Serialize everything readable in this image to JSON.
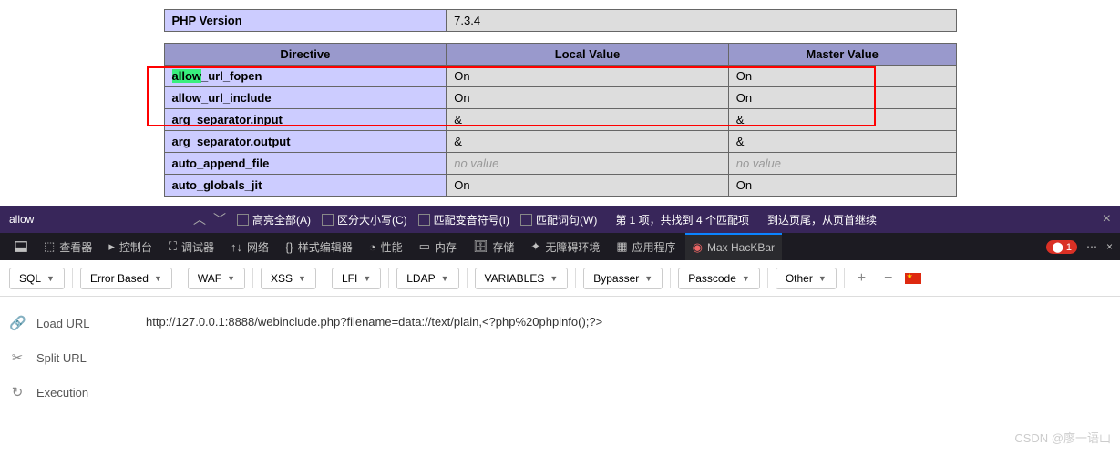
{
  "php_version_label": "PHP Version",
  "php_version_value": "7.3.4",
  "table_headers": {
    "directive": "Directive",
    "local": "Local Value",
    "master": "Master Value"
  },
  "directives": [
    {
      "name_prefix_hl": "allow",
      "name_rest": "_url_fopen",
      "local": "On",
      "master": "On"
    },
    {
      "name": "allow_url_include",
      "local": "On",
      "master": "On"
    },
    {
      "name": "arg_separator.input",
      "local": "&",
      "master": "&"
    },
    {
      "name": "arg_separator.output",
      "local": "&",
      "master": "&"
    },
    {
      "name": "auto_append_file",
      "local": "no value",
      "master": "no value",
      "novalue": true
    },
    {
      "name": "auto_globals_jit",
      "local": "On",
      "master": "On"
    }
  ],
  "search": {
    "query": "allow",
    "highlight_all": "高亮全部(A)",
    "match_case": "区分大小写(C)",
    "match_diacritics": "匹配变音符号(I)",
    "whole_words": "匹配词句(W)",
    "status": "第 1 项，共找到 4 个匹配项",
    "wrap_msg": "到达页尾，从页首继续"
  },
  "devtools": {
    "inspector": "查看器",
    "console": "控制台",
    "debugger": "调试器",
    "network": "网络",
    "style": "样式编辑器",
    "performance": "性能",
    "memory": "内存",
    "storage": "存储",
    "accessibility": "无障碍环境",
    "application": "应用程序",
    "hackbar": "Max HacKBar",
    "error_count": "1"
  },
  "hackbar_menus": {
    "sql": "SQL",
    "error_based": "Error Based",
    "waf": "WAF",
    "xss": "XSS",
    "lfi": "LFI",
    "ldap": "LDAP",
    "variables": "VARIABLES",
    "bypasser": "Bypasser",
    "passcode": "Passcode",
    "other": "Other"
  },
  "hackbar_side": {
    "load": "Load URL",
    "split": "Split URL",
    "execution": "Execution"
  },
  "url_value": "http://127.0.0.1:8888/webinclude.php?filename=data://text/plain,<?php%20phpinfo();?>",
  "watermark": "CSDN @廖一语山"
}
